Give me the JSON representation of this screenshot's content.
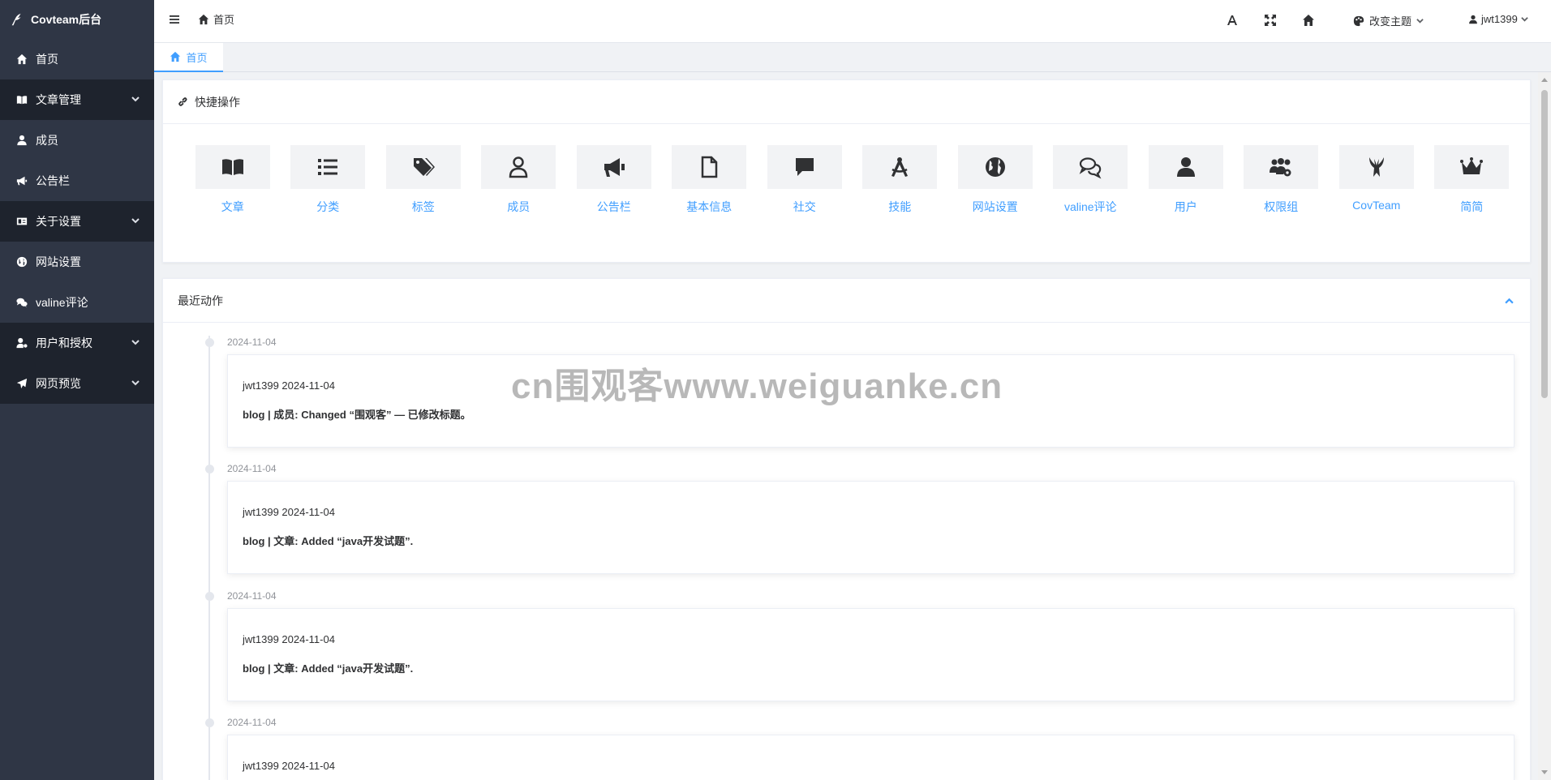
{
  "sidebar": {
    "brand": "Covteam后台",
    "items": [
      {
        "label": "首页",
        "icon": "home-icon",
        "expandable": false
      },
      {
        "label": "文章管理",
        "icon": "book-icon",
        "expandable": true
      },
      {
        "label": "成员",
        "icon": "user-icon",
        "expandable": false
      },
      {
        "label": "公告栏",
        "icon": "bullhorn-icon",
        "expandable": false
      },
      {
        "label": "关于设置",
        "icon": "id-card-icon",
        "expandable": true
      },
      {
        "label": "网站设置",
        "icon": "globe-icon",
        "expandable": false
      },
      {
        "label": "valine评论",
        "icon": "comments-icon",
        "expandable": false
      },
      {
        "label": "用户和授权",
        "icon": "user-gear-icon",
        "expandable": true
      },
      {
        "label": "网页预览",
        "icon": "paper-plane-icon",
        "expandable": true
      }
    ]
  },
  "header": {
    "breadcrumb": "首页",
    "theme_label": "改变主题",
    "user_label": "jwt1399"
  },
  "tabs": {
    "active": "首页"
  },
  "quick": {
    "title": "快捷操作",
    "items": [
      {
        "label": "文章",
        "icon": "book-open-icon"
      },
      {
        "label": "分类",
        "icon": "list-icon"
      },
      {
        "label": "标签",
        "icon": "tags-icon"
      },
      {
        "label": "成员",
        "icon": "user-outline-icon"
      },
      {
        "label": "公告栏",
        "icon": "bullhorn-icon"
      },
      {
        "label": "基本信息",
        "icon": "file-icon"
      },
      {
        "label": "社交",
        "icon": "comment-icon"
      },
      {
        "label": "技能",
        "icon": "compass-drafting-icon"
      },
      {
        "label": "网站设置",
        "icon": "globe-icon"
      },
      {
        "label": "valine评论",
        "icon": "comments-outline-icon"
      },
      {
        "label": "用户",
        "icon": "user-solid-icon"
      },
      {
        "label": "权限组",
        "icon": "users-gear-icon"
      },
      {
        "label": "CovTeam",
        "icon": "covteam-logo-icon"
      },
      {
        "label": "简简",
        "icon": "crown-icon"
      }
    ]
  },
  "recent": {
    "title": "最近动作",
    "entries": [
      {
        "date": "2024-11-04",
        "meta": "jwt1399 2024-11-04",
        "message": "blog | 成员: Changed “围观客” — 已修改标题。"
      },
      {
        "date": "2024-11-04",
        "meta": "jwt1399 2024-11-04",
        "message": "blog | 文章: Added “java开发试题”."
      },
      {
        "date": "2024-11-04",
        "meta": "jwt1399 2024-11-04",
        "message": "blog | 文章: Added “java开发试题”."
      },
      {
        "date": "2024-11-04",
        "meta": "jwt1399 2024-11-04",
        "message": ""
      }
    ]
  },
  "watermark": "cn围观客www.weiguanke.cn",
  "colors": {
    "sidebar": "#2f3645",
    "sidebar_dark": "#1e232d",
    "accent": "#409eff"
  }
}
